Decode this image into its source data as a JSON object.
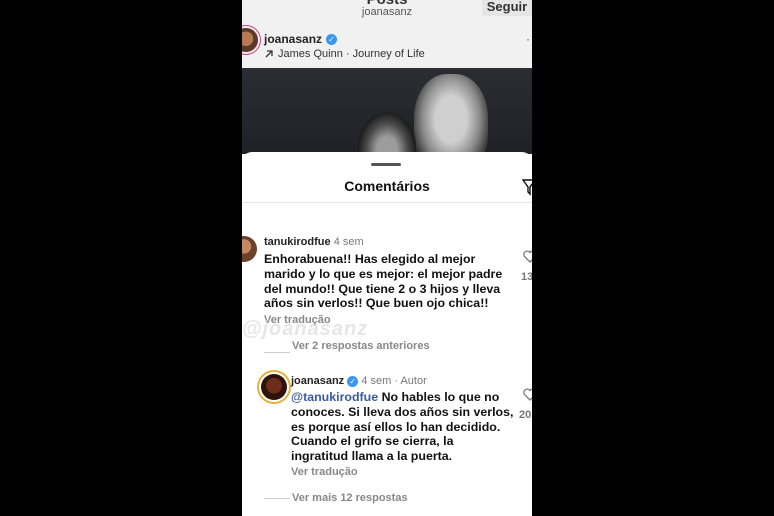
{
  "header": {
    "title": "Posts",
    "subtitle": "joanasanz",
    "follow_label": "Seguir"
  },
  "post": {
    "username": "joanasanz",
    "music": "James Quinn · Journey of Life",
    "menu_glyph": "·"
  },
  "comments_sheet": {
    "title": "Comentários",
    "comments": [
      {
        "username": "tanukirodfue",
        "time": "4 sem",
        "lines": [
          "Enhorabuena!! Has elegido al mejor",
          "marido y lo que es mejor: el mejor padre",
          "del mundo!! Que tiene 2 o 3 hijos y lleva",
          "años sin verlos!! Que buen ojo chica!!"
        ],
        "translate": "Ver tradução",
        "previous_replies": "Ver 2 respostas anteriores",
        "like_count": "13"
      },
      {
        "username": "joanasanz",
        "time": "4 sem",
        "author_tag": "· Autor",
        "mention": "@tanukirodfue",
        "lines": [
          " No hables lo que no",
          "conoces. Si lleva dos años sin verlos,",
          "es porque así ellos lo han decidido.",
          "Cuando el grifo se cierra, la",
          "ingratitud llama a la puerta."
        ],
        "translate": "Ver tradução",
        "more_replies": "Ver mais 12 respostas",
        "like_count": "20"
      }
    ]
  },
  "watermark": "@joanasanz",
  "colors": {
    "accent_blue": "#3897f0",
    "mention": "#3a5ba0",
    "story_ring": "#e8b23a"
  }
}
